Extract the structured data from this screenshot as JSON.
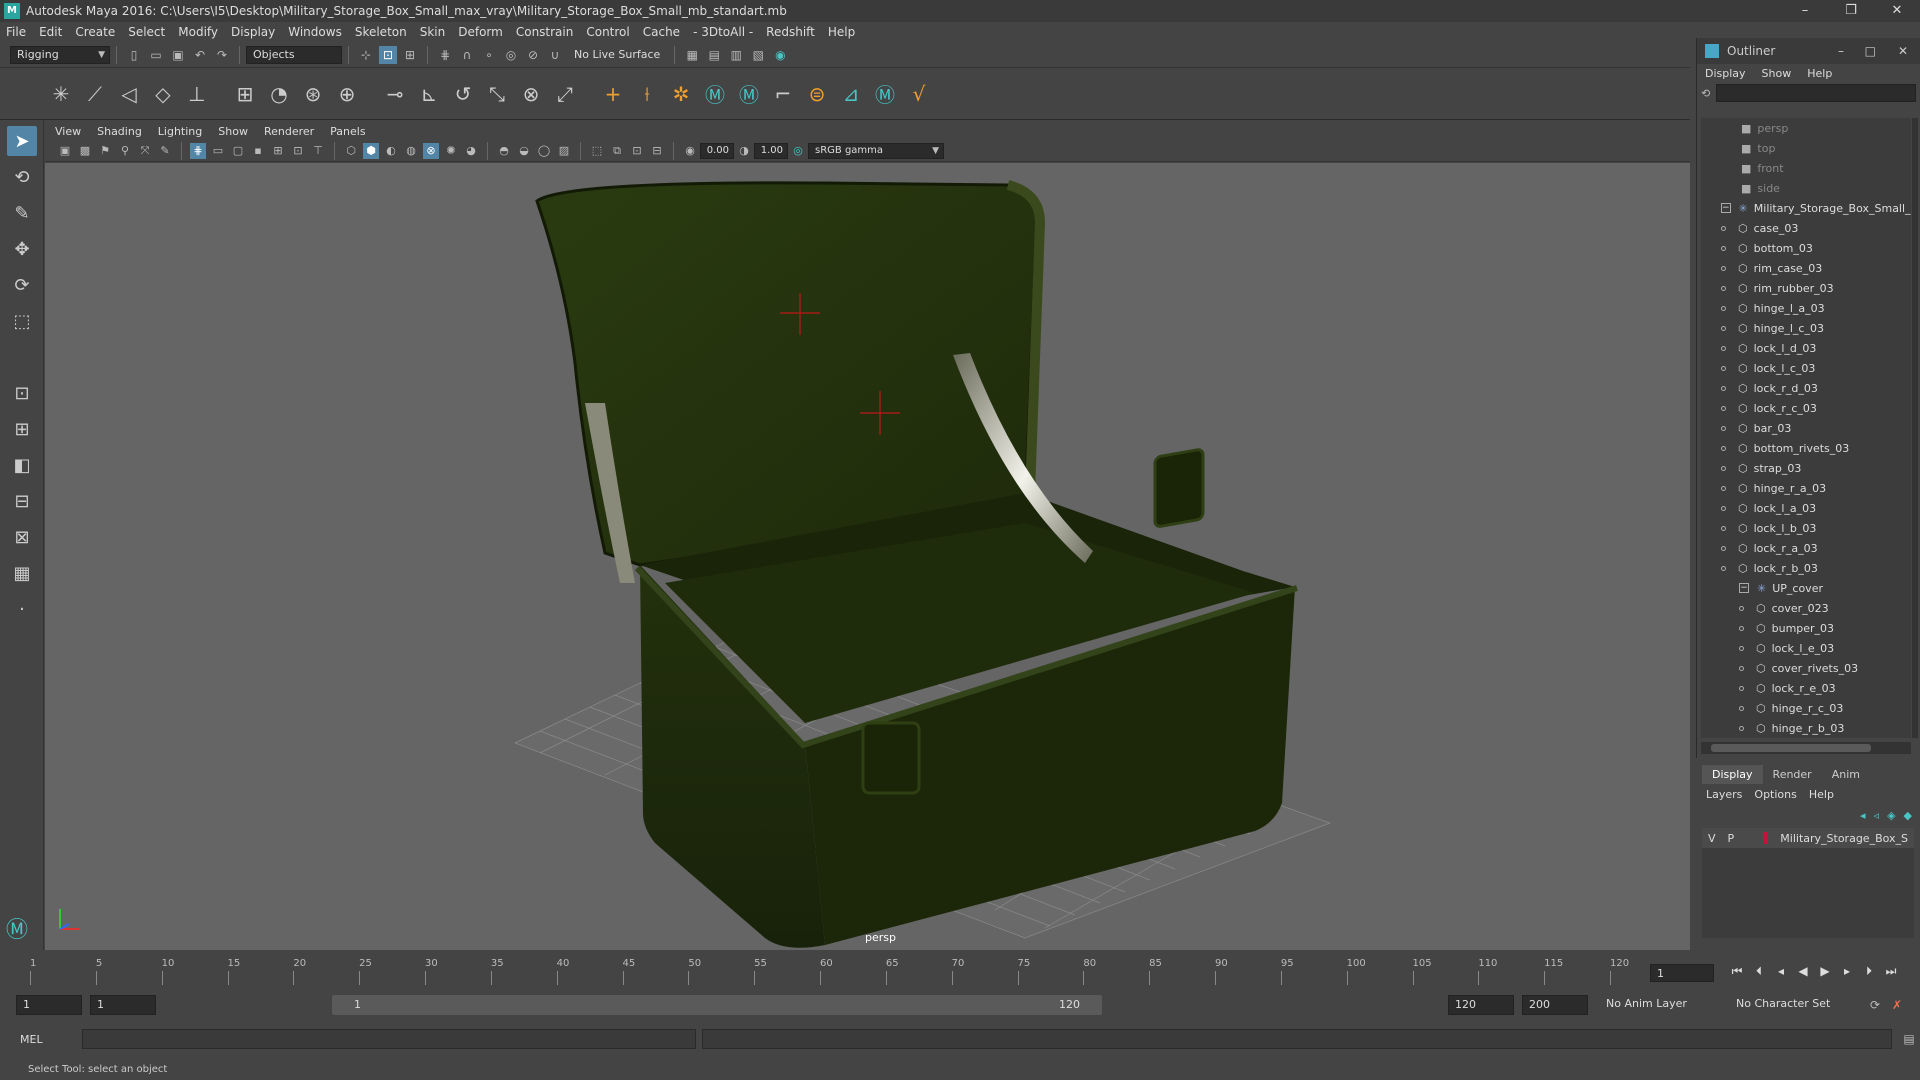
{
  "window": {
    "title": "Autodesk Maya 2016: C:\\Users\\I5\\Desktop\\Military_Storage_Box_Small_max_vray\\Military_Storage_Box_Small_mb_standart.mb",
    "minimize": "–",
    "maximize": "❐",
    "close": "✕"
  },
  "menubar": [
    "File",
    "Edit",
    "Create",
    "Select",
    "Modify",
    "Display",
    "Windows",
    "Skeleton",
    "Skin",
    "Deform",
    "Constrain",
    "Control",
    "Cache",
    "- 3DtoAll -",
    "Redshift",
    "Help"
  ],
  "statusline": {
    "mode": "Rigging",
    "select_mode": "Objects",
    "live_surface": "No Live Surface"
  },
  "viewport_menu": [
    "View",
    "Shading",
    "Lighting",
    "Show",
    "Renderer",
    "Panels"
  ],
  "viewport_toolbar": {
    "near_value": "0.00",
    "far_value": "1.00",
    "color_space": "sRGB gamma"
  },
  "viewport": {
    "camera_label": "persp",
    "box_color": "#2c3a12"
  },
  "outliner": {
    "title": "Outliner",
    "menu": [
      "Display",
      "Show",
      "Help"
    ],
    "items": [
      {
        "label": "persp",
        "type": "camera",
        "depth": 0,
        "dim": true
      },
      {
        "label": "top",
        "type": "camera",
        "depth": 0,
        "dim": true
      },
      {
        "label": "front",
        "type": "camera",
        "depth": 0,
        "dim": true
      },
      {
        "label": "side",
        "type": "camera",
        "depth": 0,
        "dim": true
      },
      {
        "label": "Military_Storage_Box_Small_r",
        "type": "group",
        "depth": 0,
        "expanded": true
      },
      {
        "label": "case_03",
        "type": "mesh",
        "depth": 1
      },
      {
        "label": "bottom_03",
        "type": "mesh",
        "depth": 1
      },
      {
        "label": "rim_case_03",
        "type": "mesh",
        "depth": 1
      },
      {
        "label": "rim_rubber_03",
        "type": "mesh",
        "depth": 1
      },
      {
        "label": "hinge_l_a_03",
        "type": "mesh",
        "depth": 1
      },
      {
        "label": "hinge_l_c_03",
        "type": "mesh",
        "depth": 1
      },
      {
        "label": "lock_l_d_03",
        "type": "mesh",
        "depth": 1
      },
      {
        "label": "lock_l_c_03",
        "type": "mesh",
        "depth": 1
      },
      {
        "label": "lock_r_d_03",
        "type": "mesh",
        "depth": 1
      },
      {
        "label": "lock_r_c_03",
        "type": "mesh",
        "depth": 1
      },
      {
        "label": "bar_03",
        "type": "mesh",
        "depth": 1
      },
      {
        "label": "bottom_rivets_03",
        "type": "mesh",
        "depth": 1
      },
      {
        "label": "strap_03",
        "type": "mesh",
        "depth": 1
      },
      {
        "label": "hinge_r_a_03",
        "type": "mesh",
        "depth": 1
      },
      {
        "label": "lock_l_a_03",
        "type": "mesh",
        "depth": 1
      },
      {
        "label": "lock_l_b_03",
        "type": "mesh",
        "depth": 1
      },
      {
        "label": "lock_r_a_03",
        "type": "mesh",
        "depth": 1
      },
      {
        "label": "lock_r_b_03",
        "type": "mesh",
        "depth": 1
      },
      {
        "label": "UP_cover",
        "type": "group",
        "depth": 1,
        "expanded": true
      },
      {
        "label": "cover_023",
        "type": "mesh",
        "depth": 2
      },
      {
        "label": "bumper_03",
        "type": "mesh",
        "depth": 2
      },
      {
        "label": "lock_l_e_03",
        "type": "mesh",
        "depth": 2
      },
      {
        "label": "cover_rivets_03",
        "type": "mesh",
        "depth": 2
      },
      {
        "label": "lock_r_e_03",
        "type": "mesh",
        "depth": 2
      },
      {
        "label": "hinge_r_c_03",
        "type": "mesh",
        "depth": 2
      },
      {
        "label": "hinge_r_b_03",
        "type": "mesh",
        "depth": 2
      }
    ]
  },
  "layers": {
    "tabs": [
      "Display",
      "Render",
      "Anim"
    ],
    "active_tab": "Display",
    "menu": [
      "Layers",
      "Options",
      "Help"
    ],
    "rows": [
      {
        "v": "V",
        "p": "P",
        "name": "Military_Storage_Box_S",
        "color": "#c0143c"
      }
    ]
  },
  "timeslider": {
    "ticks": [
      1,
      5,
      10,
      15,
      20,
      25,
      30,
      35,
      40,
      45,
      50,
      55,
      60,
      65,
      70,
      75,
      80,
      85,
      90,
      95,
      100,
      105,
      110,
      115,
      120
    ],
    "max": 120,
    "current_frame": "1"
  },
  "rangebar": {
    "start": "1",
    "playback_start": "1",
    "slider_start": "1",
    "slider_end": "120",
    "playback_end": "120",
    "end": "200",
    "anim_layer": "No Anim Layer",
    "character_set": "No Character Set"
  },
  "mel": {
    "label": "MEL"
  },
  "helpline": "Select Tool: select an object"
}
